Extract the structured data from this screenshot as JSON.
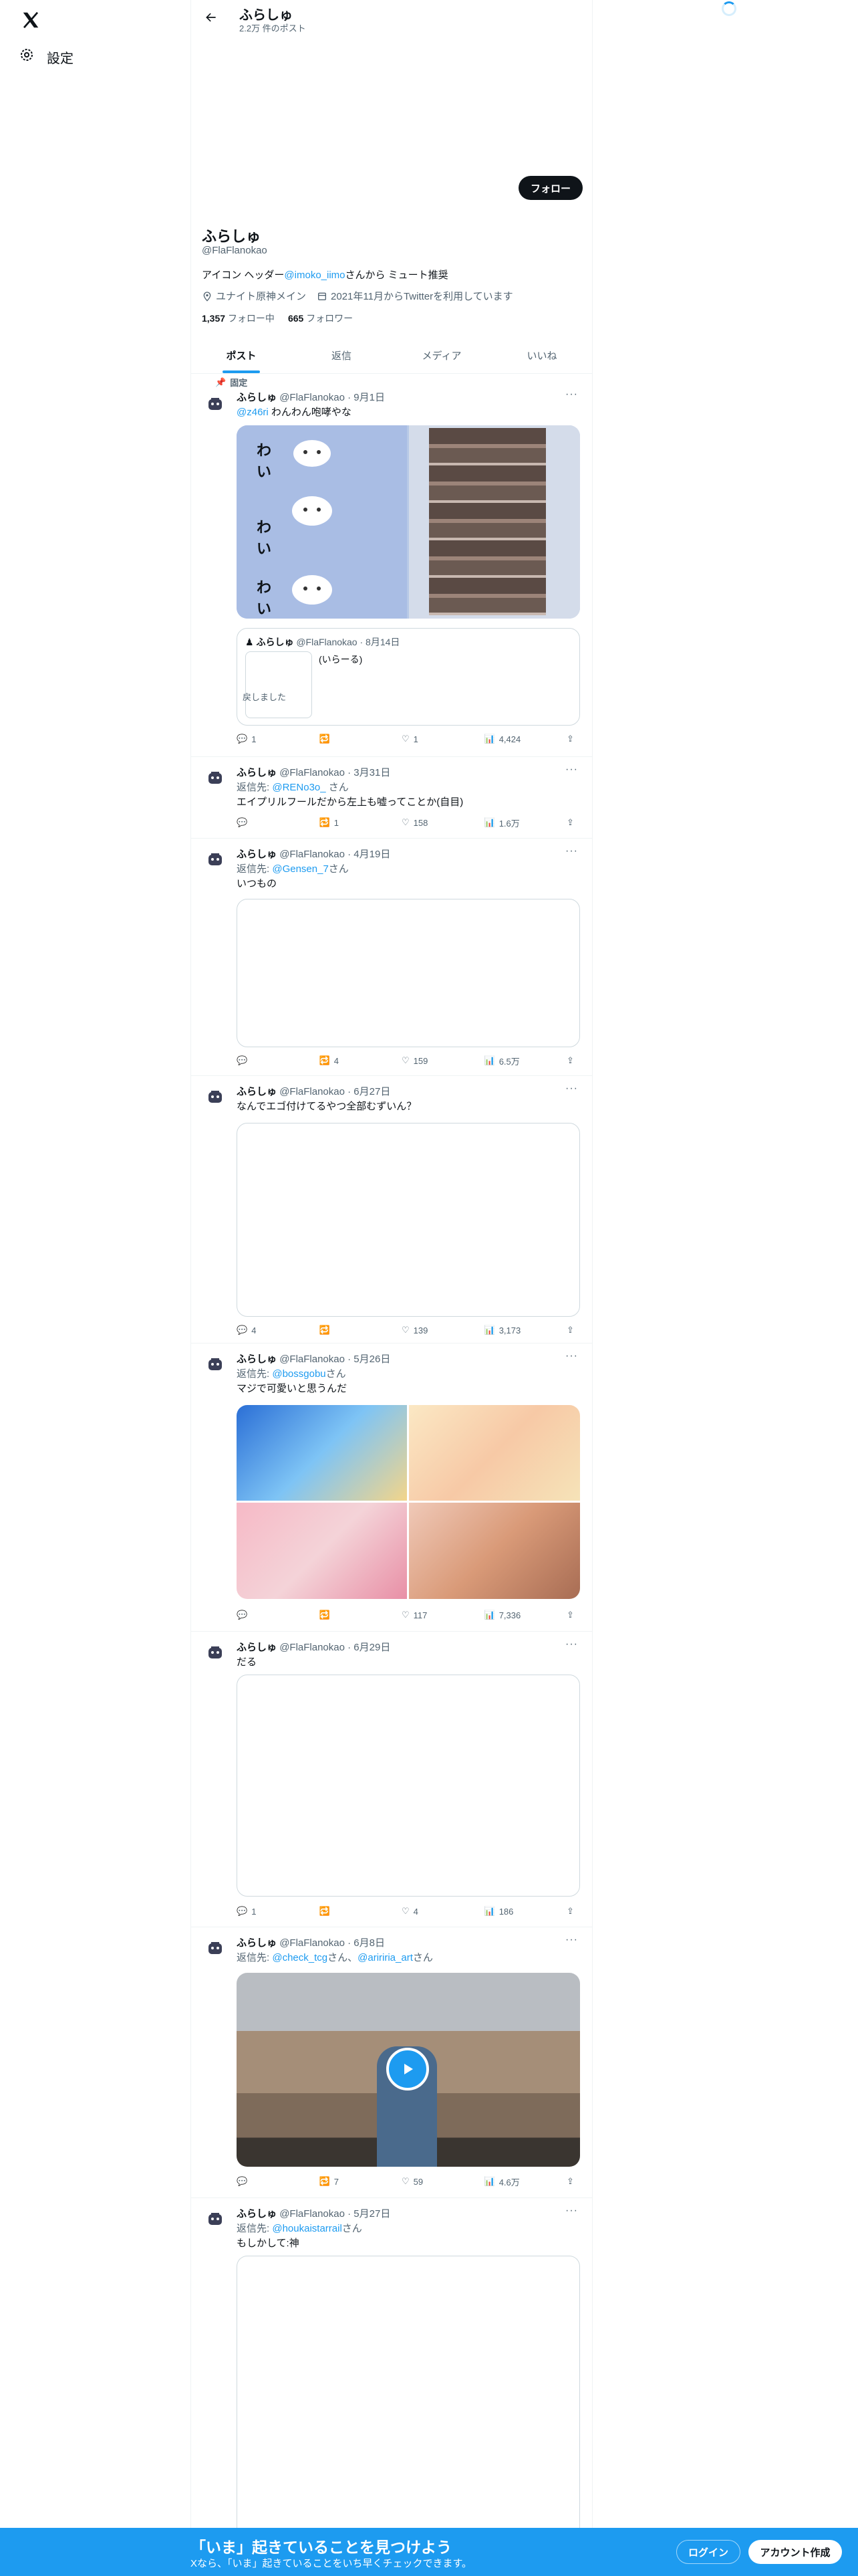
{
  "nav": {
    "settings_label": "設定"
  },
  "header": {
    "name": "ふらしゅ",
    "post_count": "2.2万 件のポスト"
  },
  "profile": {
    "follow_label": "フォロー",
    "name": "ふらしゅ",
    "handle": "@FlaFlanokao",
    "bio_prefix": "アイコン ヘッダー",
    "bio_link": "@imoko_iimo",
    "bio_suffix": "さんから ミュート推奨",
    "location": "ユナイト原神メイン",
    "joined": "2021年11月からTwitterを利用しています",
    "following_count": "1,357",
    "following_label": "フォロー中",
    "followers_count": "665",
    "followers_label": "フォロワー"
  },
  "tabs": [
    "ポスト",
    "返信",
    "メディア",
    "いいね"
  ],
  "tweets": [
    {
      "pinned": "固定",
      "name": "ふらしゅ",
      "meta": "@FlaFlanokao · 9月1日",
      "mention": "@z46ri",
      "text": " わんわん咆哮やな",
      "quote": {
        "name": "ふらしゅ",
        "meta": "@FlaFlanokao · 8月14日",
        "text": "(いらーる)",
        "thumb_text": "戻しました"
      },
      "stats": {
        "reply": "1",
        "retweet": "",
        "like": "1",
        "views": "4,424"
      }
    },
    {
      "name": "ふらしゅ",
      "meta": "@FlaFlanokao · 3月31日",
      "reply_to_prefix": "返信先: ",
      "reply_to": "@RENo3o_",
      "reply_to_suffix": " さん",
      "text": "エイプリルフールだから左上も嘘ってことか(自目)",
      "stats": {
        "reply": "",
        "retweet": "1",
        "like": "158",
        "views": "1.6万"
      }
    },
    {
      "name": "ふらしゅ",
      "meta": "@FlaFlanokao · 4月19日",
      "reply_to_prefix": "返信先: ",
      "reply_to": "@Gensen_7",
      "reply_to_suffix": "さん",
      "text": "いつもの",
      "stats": {
        "reply": "",
        "retweet": "4",
        "like": "159",
        "views": "6.5万"
      }
    },
    {
      "name": "ふらしゅ",
      "meta": "@FlaFlanokao · 6月27日",
      "text": "なんでエゴ付けてるやつ全部むずいん？",
      "stats": {
        "reply": "4",
        "retweet": "",
        "like": "139",
        "views": "3,173"
      }
    },
    {
      "name": "ふらしゅ",
      "meta": "@FlaFlanokao · 5月26日",
      "reply_to_prefix": "返信先: ",
      "reply_to": "@bossgobu",
      "reply_to_suffix": "さん",
      "text": "マジで可愛いと思うんだ",
      "stats": {
        "reply": "",
        "retweet": "",
        "like": "117",
        "views": "7,336"
      }
    },
    {
      "name": "ふらしゅ",
      "meta": "@FlaFlanokao · 6月29日",
      "text": "だる",
      "stats": {
        "reply": "1",
        "retweet": "",
        "like": "4",
        "views": "186"
      }
    },
    {
      "name": "ふらしゅ",
      "meta": "@FlaFlanokao · 6月8日",
      "reply_to_prefix": "返信先: ",
      "reply_to": "@check_tcg",
      "reply_to_mid": "さん、",
      "reply_to2": "@aririria_art",
      "reply_to_suffix": "さん",
      "stats": {
        "reply": "",
        "retweet": "7",
        "like": "59",
        "views": "4.6万"
      }
    },
    {
      "name": "ふらしゅ",
      "meta": "@FlaFlanokao · 5月27日",
      "reply_to_prefix": "返信先: ",
      "reply_to": "@houkaistarrail",
      "reply_to_suffix": "さん",
      "text": "もしかして:神"
    }
  ],
  "media": {
    "wari_text": "わい"
  },
  "banner": {
    "title": "「いま」起きていることを見つけよう",
    "subtitle": "Xなら、「いま」起きていることをいち早くチェックできます。",
    "login": "ログイン",
    "signup": "アカウント作成"
  },
  "colors": {
    "accent": "#1d9bf0",
    "text": "#0f1419",
    "muted": "#536471",
    "border": "#eff3f4"
  }
}
